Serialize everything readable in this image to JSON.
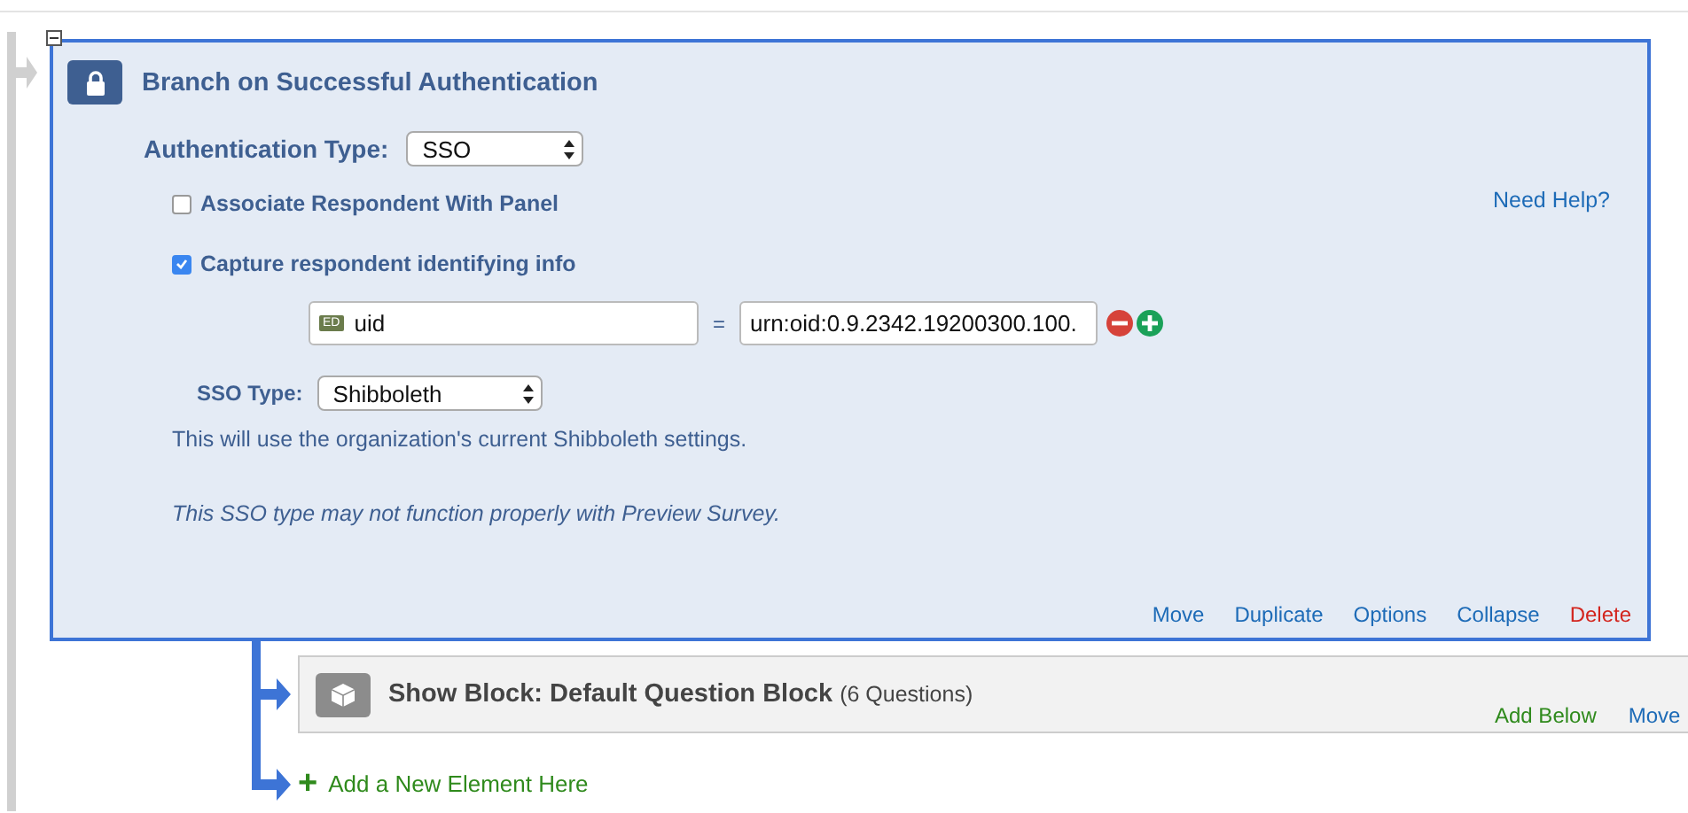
{
  "branch": {
    "title": "Branch on Successful Authentication",
    "expanded": true,
    "auth_type": {
      "label": "Authentication Type:",
      "value": "SSO"
    },
    "help_link": "Need Help?",
    "options": [
      {
        "label": "Associate Respondent With Panel",
        "checked": false
      },
      {
        "label": "Capture respondent identifying info",
        "checked": true
      }
    ],
    "mapping": {
      "badge": "ED",
      "field": "uid",
      "equals": "=",
      "value": "urn:oid:0.9.2342.19200300.100."
    },
    "sso_type": {
      "label": "SSO Type:",
      "value": "Shibboleth"
    },
    "note": "This will use the organization's current Shibboleth settings.",
    "warning": "This SSO type may not function properly with Preview Survey.",
    "actions": [
      {
        "label": "Move",
        "kind": "normal"
      },
      {
        "label": "Duplicate",
        "kind": "normal"
      },
      {
        "label": "Options",
        "kind": "normal"
      },
      {
        "label": "Collapse",
        "kind": "normal"
      },
      {
        "label": "Delete",
        "kind": "danger"
      }
    ]
  },
  "show_block": {
    "title": "Show Block: Default Question Block",
    "count": "(6 Questions)",
    "actions": [
      {
        "label": "Add Below",
        "kind": "add"
      },
      {
        "label": "Move",
        "kind": "normal"
      }
    ]
  },
  "add_element": {
    "icon": "+",
    "label": "Add a New Element Here"
  }
}
